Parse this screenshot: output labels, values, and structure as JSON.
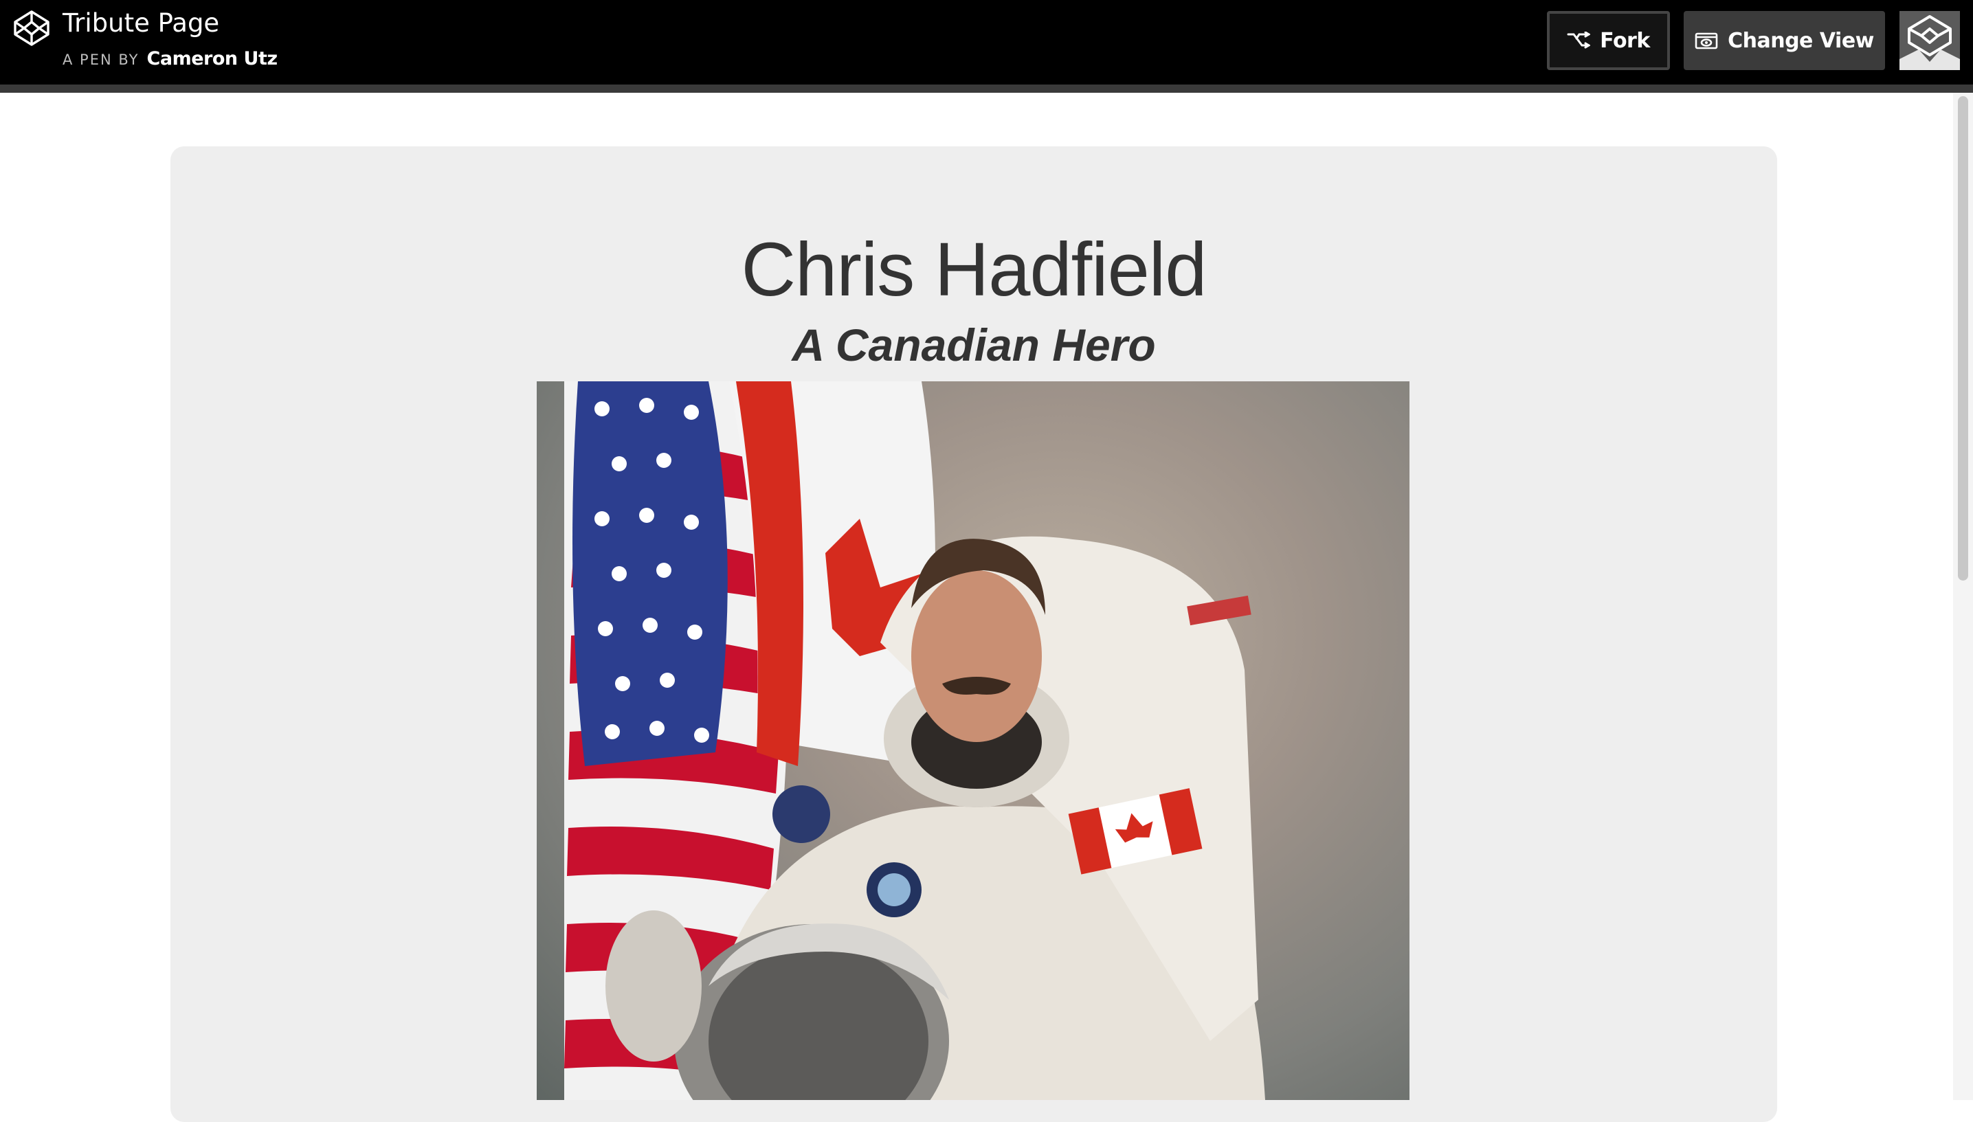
{
  "header": {
    "pen_title": "Tribute Page",
    "pen_by_label": "A PEN BY",
    "author": "Cameron Utz",
    "fork_label": "Fork",
    "change_view_label": "Change View",
    "logo_icon": "codepen-logo-icon",
    "fork_icon": "fork-icon",
    "change_view_icon": "change-view-icon"
  },
  "main": {
    "title": "Chris Hadfield",
    "subtitle": "A Canadian Hero",
    "photo": "astronaut-portrait"
  },
  "colors": {
    "header_bg": "#000000",
    "card_bg": "#eeeeee",
    "text": "#333333",
    "button_bg": "#3b3b3b"
  }
}
